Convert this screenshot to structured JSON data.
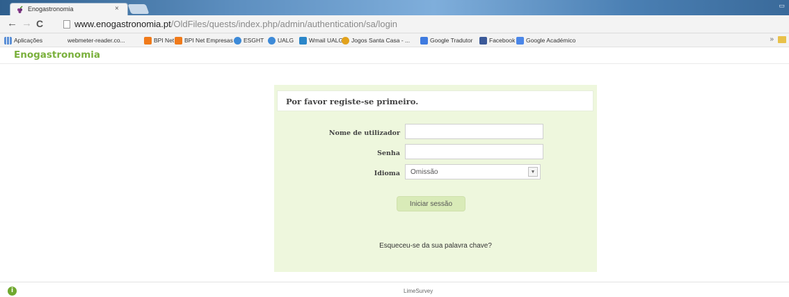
{
  "browser": {
    "tab_title": "Enogastronomia",
    "tab_close": "×",
    "url_host": "www.enogastronomia.pt",
    "url_path": "/OldFiles/quests/index.php/admin/authentication/sa/login",
    "bookmarks": [
      {
        "label": "Aplicações",
        "icon": "apps-grid-icon",
        "color": "#5b8fd6"
      },
      {
        "label": "webmeter-reader.co...",
        "icon": "page-icon",
        "color": "#ffffff"
      },
      {
        "label": "BPI Net",
        "icon": "bpi-icon",
        "color": "#f07a1a"
      },
      {
        "label": "BPI Net Empresas",
        "icon": "bpi-icon",
        "color": "#f07a1a"
      },
      {
        "label": "ESGHT",
        "icon": "globe-icon",
        "color": "#3d8ad8"
      },
      {
        "label": "UALG",
        "icon": "globe-icon",
        "color": "#3d8ad8"
      },
      {
        "label": "Wmail UALG",
        "icon": "mail-icon",
        "color": "#2a86c9"
      },
      {
        "label": "Jogos Santa Casa - ...",
        "icon": "lottery-icon",
        "color": "#e2a21c"
      },
      {
        "label": "Google Tradutor",
        "icon": "translate-icon",
        "color": "#3f7be0"
      },
      {
        "label": "Facebook",
        "icon": "facebook-icon",
        "color": "#3b5998"
      },
      {
        "label": "Google Académico",
        "icon": "scholar-icon",
        "color": "#4a86e8"
      }
    ],
    "more_bookmarks": "»"
  },
  "site": {
    "title": "Enogastronomia"
  },
  "login": {
    "message": "Por favor registe-se primeiro.",
    "username_label": "Nome de utilizador",
    "username_value": "",
    "password_label": "Senha",
    "password_value": "",
    "language_label": "Idioma",
    "language_value": "Omissão",
    "submit_label": "Iniciar sessão",
    "forgot_label": "Esqueceu-se da sua palavra chave?"
  },
  "footer": {
    "text": "LimeSurvey"
  },
  "colors": {
    "brand_green": "#7ab03c",
    "panel_bg": "#eef7dd",
    "button_bg": "#d9ebb8"
  }
}
